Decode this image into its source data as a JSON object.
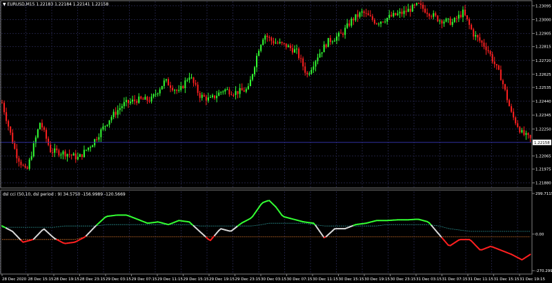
{
  "price_panel": {
    "header": "EURUSD,M15  1.22183 1.22184 1.22141 1.22158",
    "current_price_label": "1.22158",
    "current_price": 1.22158,
    "y_ticks": [
      "1.23095",
      "1.23000",
      "1.22905",
      "1.22815",
      "1.22720",
      "1.22625",
      "1.22535",
      "1.22440",
      "1.22345",
      "1.22250",
      "1.22065",
      "1.21975",
      "1.21880"
    ],
    "y_tick_values": [
      1.23095,
      1.23,
      1.22905,
      1.22815,
      1.2272,
      1.22625,
      1.22535,
      1.2244,
      1.22345,
      1.2225,
      1.22065,
      1.21975,
      1.2188
    ],
    "ylim": [
      1.2185,
      1.23125
    ]
  },
  "indicator_panel": {
    "header": "dsl cci (50,10, dsl period : 9) 34.5750 -156.9989 -120.5669",
    "y_ticks": [
      "299.7115",
      "0.00",
      "-270.299"
    ],
    "y_tick_values": [
      299.7115,
      0,
      -270.299
    ],
    "ylim": [
      -290,
      315
    ]
  },
  "x_axis": {
    "labels": [
      "28 Dec 2020",
      "28 Dec 15:15",
      "28 Dec 19:15",
      "28 Dec 23:15",
      "29 Dec 03:15",
      "29 Dec 07:15",
      "29 Dec 11:15",
      "29 Dec 15:15",
      "29 Dec 19:15",
      "29 Dec 23:15",
      "30 Dec 03:15",
      "30 Dec 07:15",
      "30 Dec 11:15",
      "30 Dec 15:15",
      "30 Dec 19:15",
      "30 Dec 23:15",
      "31 Dec 03:15",
      "31 Dec 07:15",
      "31 Dec 11:15",
      "31 Dec 15:15",
      "31 Dec 19:15"
    ]
  },
  "colors": {
    "background": "#000000",
    "grid": "#202040",
    "bull": "#33ff33",
    "bear": "#ff2020",
    "neutral_line": "#d8d8d8",
    "upper_level": "#2a8c8c",
    "lower_level": "#d0702a",
    "price_line": "#3030a0",
    "axis_text": "#ffffff"
  },
  "chart_data": [
    {
      "type": "line",
      "title": "EURUSD,M15",
      "x_unit": "bar",
      "x": [
        0,
        20,
        35,
        55,
        70,
        95,
        110,
        130,
        155,
        175,
        195,
        215,
        235,
        255,
        270,
        285,
        300,
        320,
        335,
        355,
        370,
        378,
        390,
        410,
        425,
        440,
        455,
        470,
        490,
        505,
        520,
        540,
        560,
        580,
        600,
        615,
        630,
        650,
        665,
        680,
        700,
        720,
        735,
        750,
        765
      ],
      "series": [
        {
          "values": [
            1.2243,
            1.2208,
            1.2195,
            1.223,
            1.221,
            1.2208,
            1.2205,
            1.2215,
            1.2232,
            1.2242,
            1.2245,
            1.2245,
            1.2258,
            1.225,
            1.2262,
            1.2248,
            1.2245,
            1.2252,
            1.225,
            1.2252,
            1.228,
            1.229,
            1.2285,
            1.2282,
            1.2278,
            1.2262,
            1.2275,
            1.2285,
            1.229,
            1.23,
            1.2305,
            1.2298,
            1.2302,
            1.2305,
            1.231,
            1.2305,
            1.23,
            1.2298,
            1.2305,
            1.229,
            1.228,
            1.226,
            1.2235,
            1.2222,
            1.2217
          ]
        }
      ]
    },
    {
      "type": "line",
      "title": "dsl cci (50,10, dsl period : 9)",
      "x_unit": "bar",
      "x": [
        0,
        15,
        30,
        45,
        60,
        75,
        90,
        105,
        120,
        135,
        150,
        165,
        180,
        195,
        210,
        225,
        240,
        255,
        270,
        285,
        300,
        315,
        330,
        345,
        360,
        375,
        385,
        395,
        405,
        420,
        435,
        450,
        465,
        480,
        495,
        510,
        525,
        540,
        555,
        570,
        585,
        600,
        615,
        630,
        645,
        660,
        675,
        690,
        705,
        720,
        735,
        750,
        765
      ],
      "series": [
        {
          "name": "dsl cci",
          "values": [
            60,
            20,
            -60,
            -40,
            40,
            -30,
            -70,
            -60,
            -20,
            60,
            130,
            140,
            140,
            110,
            80,
            90,
            70,
            100,
            90,
            20,
            -50,
            40,
            20,
            80,
            120,
            230,
            250,
            200,
            130,
            110,
            90,
            80,
            -30,
            40,
            40,
            70,
            80,
            100,
            100,
            105,
            105,
            110,
            90,
            0,
            -90,
            -40,
            -40,
            -120,
            -90,
            -120,
            -150,
            -190,
            -140
          ]
        },
        {
          "name": "upper level",
          "values": [
            50,
            50,
            50,
            50,
            50,
            50,
            60,
            60,
            60,
            60,
            70,
            70,
            70,
            70,
            70,
            70,
            70,
            70,
            70,
            60,
            60,
            60,
            60,
            60,
            60,
            70,
            80,
            80,
            80,
            80,
            80,
            70,
            60,
            60,
            60,
            60,
            60,
            60,
            70,
            70,
            70,
            70,
            70,
            60,
            40,
            30,
            20,
            20,
            20,
            20,
            20,
            20,
            20
          ]
        },
        {
          "name": "lower level",
          "values": [
            -40,
            -40,
            -40,
            -40,
            -40,
            -40,
            -40,
            -40,
            -20,
            -20,
            -20,
            -20,
            -20,
            -20,
            -20,
            -20,
            -20,
            -20,
            -20,
            -20,
            -20,
            -20,
            -20,
            -20,
            -20,
            -20,
            -20,
            -20,
            -20,
            -20,
            -20,
            -20,
            -20,
            -20,
            -20,
            -20,
            -20,
            -20,
            -20,
            -20,
            -20,
            -20,
            -20,
            -20,
            -20,
            -20,
            -20,
            -20,
            -20,
            -20,
            -20,
            -20,
            -20
          ]
        }
      ]
    }
  ]
}
